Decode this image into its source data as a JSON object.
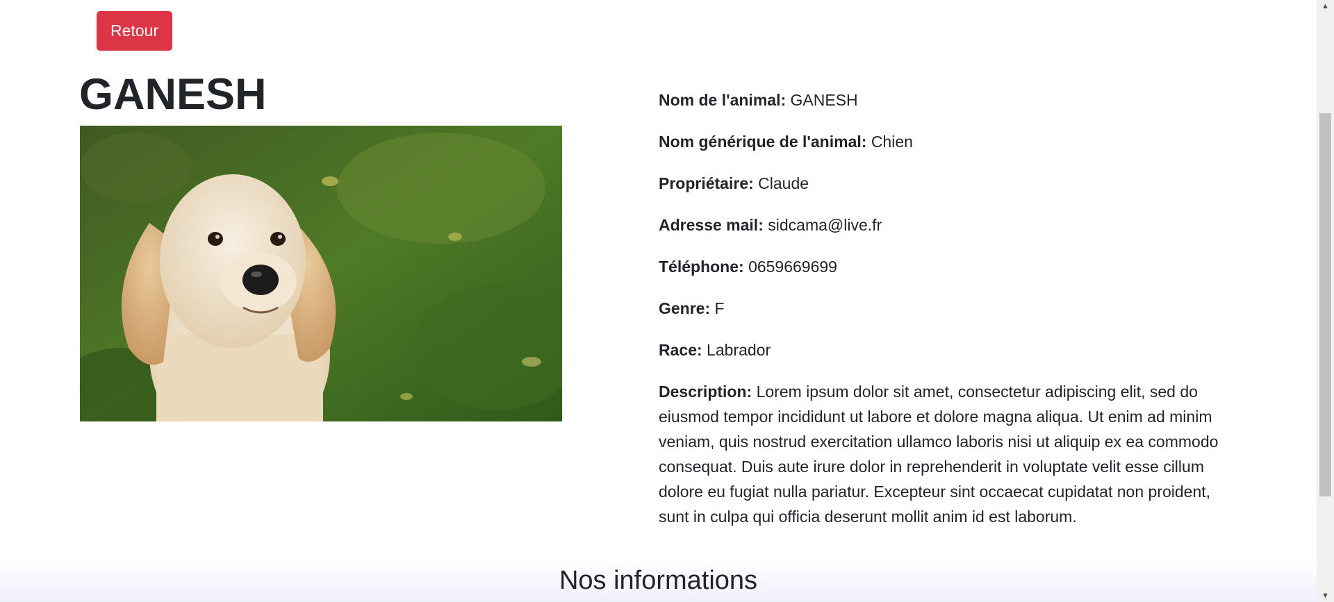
{
  "header": {
    "back_button_label": "Retour"
  },
  "animal": {
    "title": "GANESH",
    "photo_icon": "puppy-photo",
    "fields": [
      {
        "label": "Nom de l'animal:",
        "value": "GANESH"
      },
      {
        "label": "Nom générique de l'animal:",
        "value": "Chien"
      },
      {
        "label": "Propriétaire:",
        "value": "Claude"
      },
      {
        "label": "Adresse mail:",
        "value": "sidcama@live.fr"
      },
      {
        "label": "Téléphone:",
        "value": "0659669699"
      },
      {
        "label": "Genre:",
        "value": "F"
      },
      {
        "label": "Race:",
        "value": "Labrador"
      },
      {
        "label": "Description:",
        "value": "Lorem ipsum dolor sit amet, consectetur adipiscing elit, sed do eiusmod tempor incididunt ut labore et dolore magna aliqua. Ut enim ad minim veniam, quis nostrud exercitation ullamco laboris nisi ut aliquip ex ea commodo consequat. Duis aute irure dolor in reprehenderit in voluptate velit esse cillum dolore eu fugiat nulla pariatur. Excepteur sint occaecat cupidatat non proident, sunt in culpa qui officia deserunt mollit anim id est laborum."
      }
    ]
  },
  "footer": {
    "title": "Nos informations"
  },
  "colors": {
    "primary_button": "#dc3545",
    "text": "#212529"
  }
}
